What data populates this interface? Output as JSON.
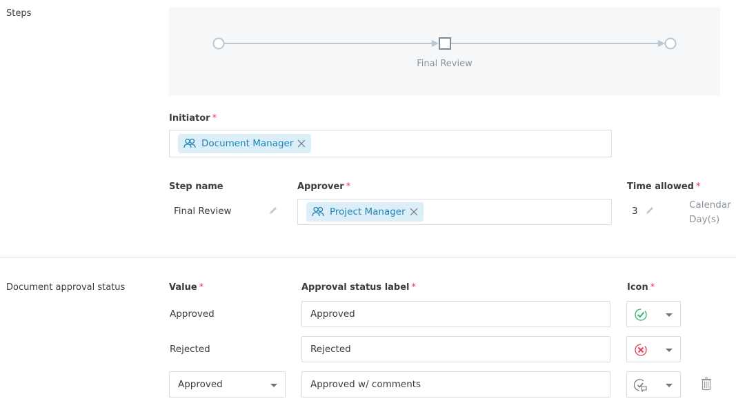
{
  "steps_section": {
    "label": "Steps",
    "flow": {
      "nodes": [
        {
          "type": "start",
          "shape": "circle"
        },
        {
          "type": "step",
          "shape": "square",
          "label": "Final Review"
        },
        {
          "type": "end",
          "shape": "circle"
        }
      ],
      "colors": {
        "line": "#b9c6cf",
        "step_border": "#7f8c97",
        "background": "#f5f7f9"
      }
    },
    "initiator": {
      "label": "Initiator",
      "required_mark": "*",
      "chips": [
        {
          "icon": "people-icon",
          "label": "Document Manager"
        }
      ]
    },
    "step_table": {
      "headers": {
        "step_name": "Step name",
        "approver": "Approver",
        "time_allowed": "Time allowed"
      },
      "required_mark": "*",
      "row": {
        "step_name": "Final Review",
        "approver_chips": [
          {
            "icon": "people-icon",
            "label": "Project Manager"
          }
        ],
        "time_allowed_value": "3",
        "time_unit_line1": "Calendar",
        "time_unit_line2": "Day(s)"
      }
    }
  },
  "approval_status_section": {
    "label": "Document approval status",
    "headers": {
      "value": "Value",
      "status_label": "Approval status label",
      "icon": "Icon"
    },
    "required_mark": "*",
    "rows": [
      {
        "value": "Approved",
        "value_editable": false,
        "status_label": "Approved",
        "icon": "approved-check-icon",
        "icon_color": "#2bb673",
        "deletable": false
      },
      {
        "value": "Rejected",
        "value_editable": false,
        "status_label": "Rejected",
        "icon": "rejected-x-icon",
        "icon_color": "#e8394b",
        "deletable": false
      },
      {
        "value": "Approved",
        "value_editable": true,
        "status_label": "Approved w/ comments",
        "icon": "approved-with-comments-icon",
        "icon_color": "#6d767e",
        "deletable": true
      }
    ]
  },
  "colors": {
    "chip_bg": "#dceef8",
    "chip_text": "#1f83b8",
    "required": "#e8394b"
  }
}
